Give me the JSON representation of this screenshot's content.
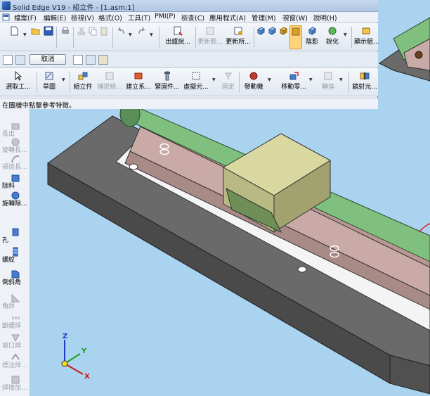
{
  "window": {
    "title": "Solid Edge V19 - 組立件 - [1.asm:1]"
  },
  "menu": {
    "items": [
      "檔案(F)",
      "編輯(E)",
      "檢視(V)",
      "格式(O)",
      "工具(T)",
      "PMI(P)",
      "檢查(C)",
      "應用程式(A)",
      "管理(M)",
      "視窗(W)",
      "說明(H)"
    ]
  },
  "std_toolbar": {
    "publish": "出爐說...",
    "update_all": "更新關...",
    "update_all2": "更新所...",
    "shading": "陰影",
    "sharpen": "銳化",
    "display": "顯示組..."
  },
  "command_bar": {
    "cancel": "取消"
  },
  "feature_toolbar": {
    "select": "選取工...",
    "sketch": "草圖",
    "assembly": "組立件",
    "capture": "捕捉組...",
    "create": "建立系...",
    "fastener": "緊固件...",
    "virtual": "虛擬元...",
    "fix": "固定",
    "motor": "發動機",
    "move": "移動零...",
    "convert": "轉換",
    "mirror": "鏡射元..."
  },
  "status": {
    "prompt": "在圖樣中點擊參考特徵。"
  },
  "left_panel": {
    "items": [
      {
        "label": "長出",
        "enabled": false
      },
      {
        "label": "旋轉長...",
        "enabled": false
      },
      {
        "label": "掃掠長...",
        "enabled": false
      },
      {
        "label": "除料",
        "enabled": true
      },
      {
        "label": "旋轉除...",
        "enabled": true
      },
      {
        "label": "孔",
        "enabled": true
      },
      {
        "label": "螺紋",
        "enabled": true
      },
      {
        "label": "倒斜角",
        "enabled": true
      },
      {
        "label": "角焊",
        "enabled": false
      },
      {
        "label": "斷續焊",
        "enabled": false
      },
      {
        "label": "坡口焊",
        "enabled": false
      },
      {
        "label": "標注焊...",
        "enabled": false
      },
      {
        "label": "焊接加...",
        "enabled": false
      }
    ]
  },
  "triad": {
    "x": "X",
    "y": "Y",
    "z": "Z"
  },
  "colors": {
    "viewport_bg": "#a9d3ee",
    "base_plate": "#787878",
    "rail_pink": "#c9aaa6",
    "rod_green": "#7fc07f",
    "block_khaki": "#d8d8a0"
  }
}
